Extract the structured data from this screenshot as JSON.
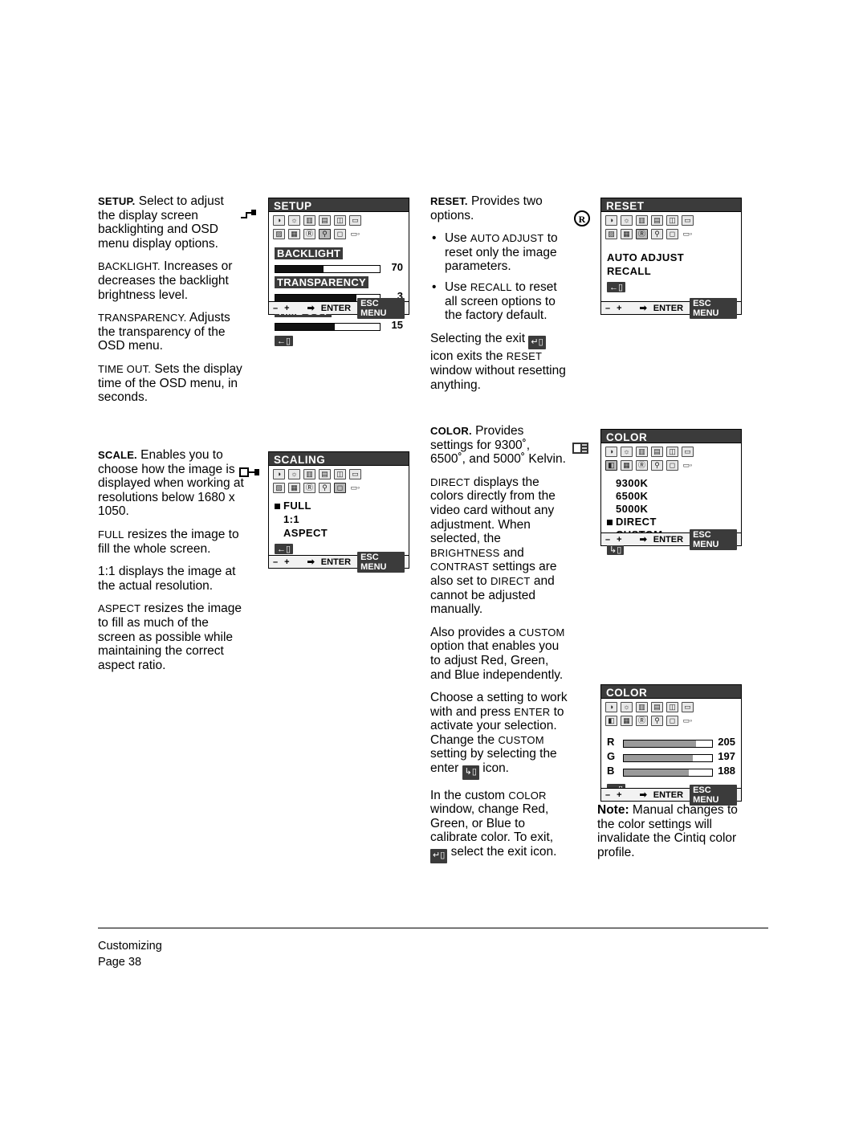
{
  "document": {
    "footer": {
      "section": "Customizing",
      "page": "Page  38"
    }
  },
  "column_setup": {
    "p1_head": "SETUP.",
    "p1": " Select to adjust the display screen backlighting and OSD menu display options.",
    "p2_head": "BACKLIGHT.",
    "p2": " Increases or decreases the backlight brightness level.",
    "p3_head": "TRANSPARENCY.",
    "p3": " Adjusts the transparency of the OSD menu.",
    "p4_head": "TIME OUT.",
    "p4": " Sets the display time of the OSD menu, in seconds."
  },
  "column_scale": {
    "p1_head": "SCALE.",
    "p1": " Enables you to choose how the image is displayed when working at resolutions below 1680 x 1050.",
    "p2_head": "FULL",
    "p2": " resizes the image to fill the whole screen.",
    "p3": "1:1 displays the image at the actual resolution.",
    "p4_head": "ASPECT",
    "p4": " resizes the image to fill as much of the screen as possible while maintaining the correct aspect ratio."
  },
  "column_reset": {
    "p1_head": "RESET.",
    "p1": " Provides two options.",
    "bullets": [
      {
        "pre": "Use ",
        "sc": "AUTO ADJUST",
        "post": " to reset only the image parameters."
      },
      {
        "pre": "Use ",
        "sc": "RECALL",
        "post": " to reset all screen options to the factory default."
      }
    ],
    "p2_a": "Selecting the exit",
    "p2_b": "icon exits the",
    "p2_sc": "RESET",
    "p2_c": " window without resetting anything."
  },
  "column_color": {
    "p1_head": "COLOR.",
    "p1": " Provides settings for 9300˚, 6500˚, and 5000˚ Kelvin.",
    "p2_sc1": "DIRECT",
    "p2_a": " displays the colors directly from the video card without any adjustment. When selected, the ",
    "p2_sc2": "BRIGHTNESS",
    "p2_b": " and ",
    "p2_sc3": "CONTRAST",
    "p2_c": " settings are also set to ",
    "p2_sc4": "DIRECT",
    "p2_d": " and cannot be adjusted manually.",
    "p3_a": "Also provides a ",
    "p3_sc": "CUSTOM",
    "p3_b": " option that enables you to adjust Red, Green, and Blue independently.",
    "p4_a": "Choose a setting to work with and press ",
    "p4_sc1": "ENTER",
    "p4_b": " to activate your selection.  Change the ",
    "p4_sc2": "CUSTOM",
    "p4_c": " setting by selecting the enter",
    "p4_d": "icon.",
    "p5_a": "In the custom ",
    "p5_sc": "COLOR",
    "p5_b": " window, change Red, Green, or Blue to calibrate color.  To exit,",
    "p5_c": "select the exit icon."
  },
  "note": {
    "label": "Note:",
    "text": " Manual changes to the color settings will invalidate the Cintiq color profile."
  },
  "osd_setup": {
    "title": "SETUP",
    "rows": [
      {
        "label": "BACKLIGHT",
        "value": "70",
        "fill": 46
      },
      {
        "label": "TRANSPARENCY",
        "value": "3",
        "fill": 78
      },
      {
        "label": "TIME OUT",
        "value": "15",
        "fill": 57
      }
    ],
    "footer": {
      "minus": "–",
      "plus": "+",
      "enter": "ENTER",
      "esc": "ESC MENU"
    }
  },
  "osd_scaling": {
    "title": "SCALING",
    "items": [
      "FULL",
      "1:1",
      "ASPECT"
    ],
    "selected": "FULL",
    "footer": {
      "minus": "–",
      "plus": "+",
      "enter": "ENTER",
      "esc": "ESC MENU"
    }
  },
  "osd_reset": {
    "title": "RESET",
    "items": [
      "AUTO  ADJUST",
      "RECALL"
    ],
    "footer": {
      "minus": "–",
      "plus": "+",
      "enter": "ENTER",
      "esc": "ESC MENU"
    }
  },
  "osd_color": {
    "title": "COLOR",
    "items": [
      "9300K",
      "6500K",
      "5000K",
      "DIRECT",
      "CUSTOM"
    ],
    "selected": "DIRECT",
    "footer": {
      "minus": "–",
      "plus": "+",
      "enter": "ENTER",
      "esc": "ESC MENU"
    }
  },
  "osd_color_custom": {
    "title": "COLOR",
    "channels": [
      {
        "label": "R",
        "value": "205",
        "fill": 82
      },
      {
        "label": "G",
        "value": "197",
        "fill": 78
      },
      {
        "label": "B",
        "value": "188",
        "fill": 74
      }
    ],
    "footer": {
      "minus": "–",
      "plus": "+",
      "enter": "ENTER",
      "esc": "ESC MENU"
    }
  },
  "icons": {
    "brightness": "◑",
    "contrast": "☀",
    "pitch": "▦",
    "phase": "▤",
    "horizontal": "◫",
    "vertical": "▭",
    "language": "▩",
    "display": "▥",
    "reset": "Ⓡ",
    "setup": "⚲",
    "scale": "◻",
    "color": "◐",
    "exit": "▭◦"
  }
}
